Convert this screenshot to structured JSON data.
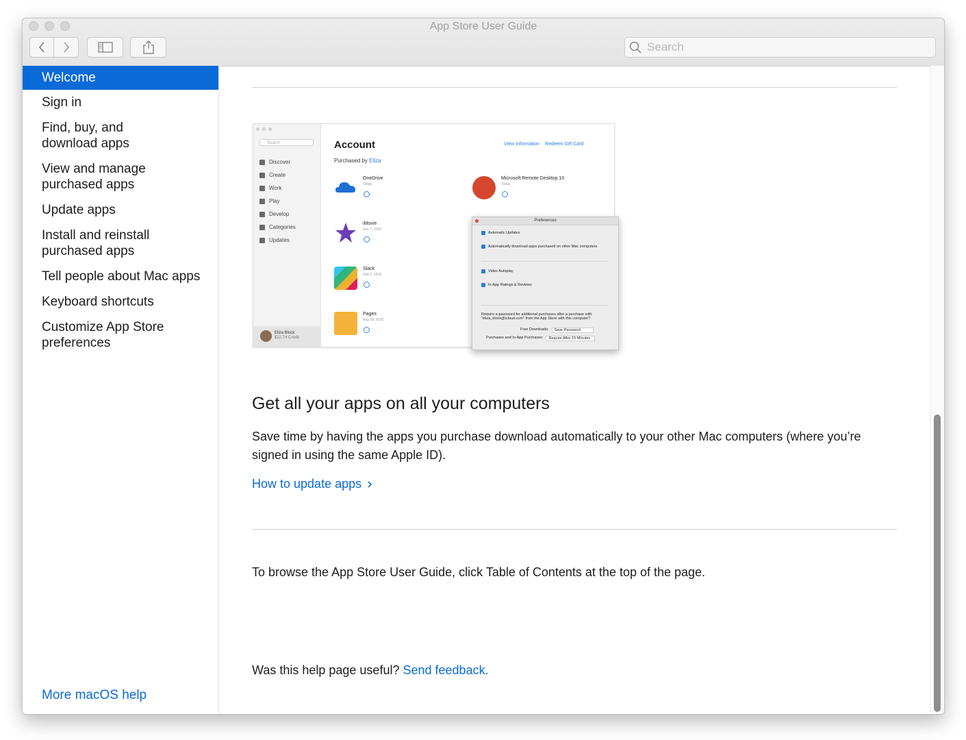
{
  "window": {
    "title": "App Store User Guide"
  },
  "toolbar": {
    "back_icon": "chevron-left-icon",
    "forward_icon": "chevron-right-icon",
    "sidebar_toggle_icon": "sidebar-icon",
    "share_icon": "share-icon",
    "search_placeholder": "Search"
  },
  "sidebar": {
    "items": [
      {
        "label": "Welcome",
        "active": true
      },
      {
        "label": "Sign in"
      },
      {
        "label": "Find, buy, and download apps"
      },
      {
        "label": "View and manage purchased apps"
      },
      {
        "label": "Update apps"
      },
      {
        "label": "Install and reinstall purchased apps"
      },
      {
        "label": "Tell people about Mac apps"
      },
      {
        "label": "Keyboard shortcuts"
      },
      {
        "label": "Customize App Store preferences"
      }
    ],
    "more_help": "More macOS help",
    "accent_color": "#0a6ad8"
  },
  "screenshot": {
    "nav": [
      "Discover",
      "Create",
      "Work",
      "Play",
      "Develop",
      "Categories",
      "Updates"
    ],
    "search": "Search",
    "user_name": "Eliza Block",
    "user_credit": "$22.74 Credit",
    "title": "Account",
    "purchased_by": "Purchased by",
    "purchased_name": "Eliza",
    "link_info": "View Information",
    "link_gift": "Redeem Gift Card",
    "apps": [
      {
        "name": "OneDrive",
        "date": "Today"
      },
      {
        "name": "Microsoft Remote Desktop 10",
        "date": "Today"
      },
      {
        "name": "iMovie",
        "date": "Sep 7, 2018"
      },
      {
        "name": "Slack",
        "date": "Sep 2, 2018"
      },
      {
        "name": "Pages",
        "date": "Aug 28, 2018"
      }
    ],
    "prefs": {
      "title": "Preferences",
      "auto_updates": "Automatic Updates",
      "auto_download": "Automatically download apps purchased on other Mac computers",
      "video_autoplay": "Video Autoplay",
      "ratings": "In-App Ratings & Reviews",
      "password_text": "Require a password for additional purchases after a purchase with \"eliza_block@icloud.com\" from the App Store with this computer?",
      "free_downloads_label": "Free Downloads:",
      "free_downloads_value": "Save Password",
      "purchases_label": "Purchases and In-App Purchases:",
      "purchases_value": "Require After 15 Minutes"
    }
  },
  "main": {
    "heading": "Get all your apps on all your computers",
    "body": "Save time by having the apps you purchase download automatically to your other Mac computers (where you’re signed in using the same Apple ID).",
    "link": "How to update apps",
    "browse_text": "To browse the App Store User Guide, click Table of Contents at the top of the page.",
    "feedback_prompt": "Was this help page useful?",
    "feedback_link": "Send feedback.",
    "link_color": "#0a6ad8"
  }
}
